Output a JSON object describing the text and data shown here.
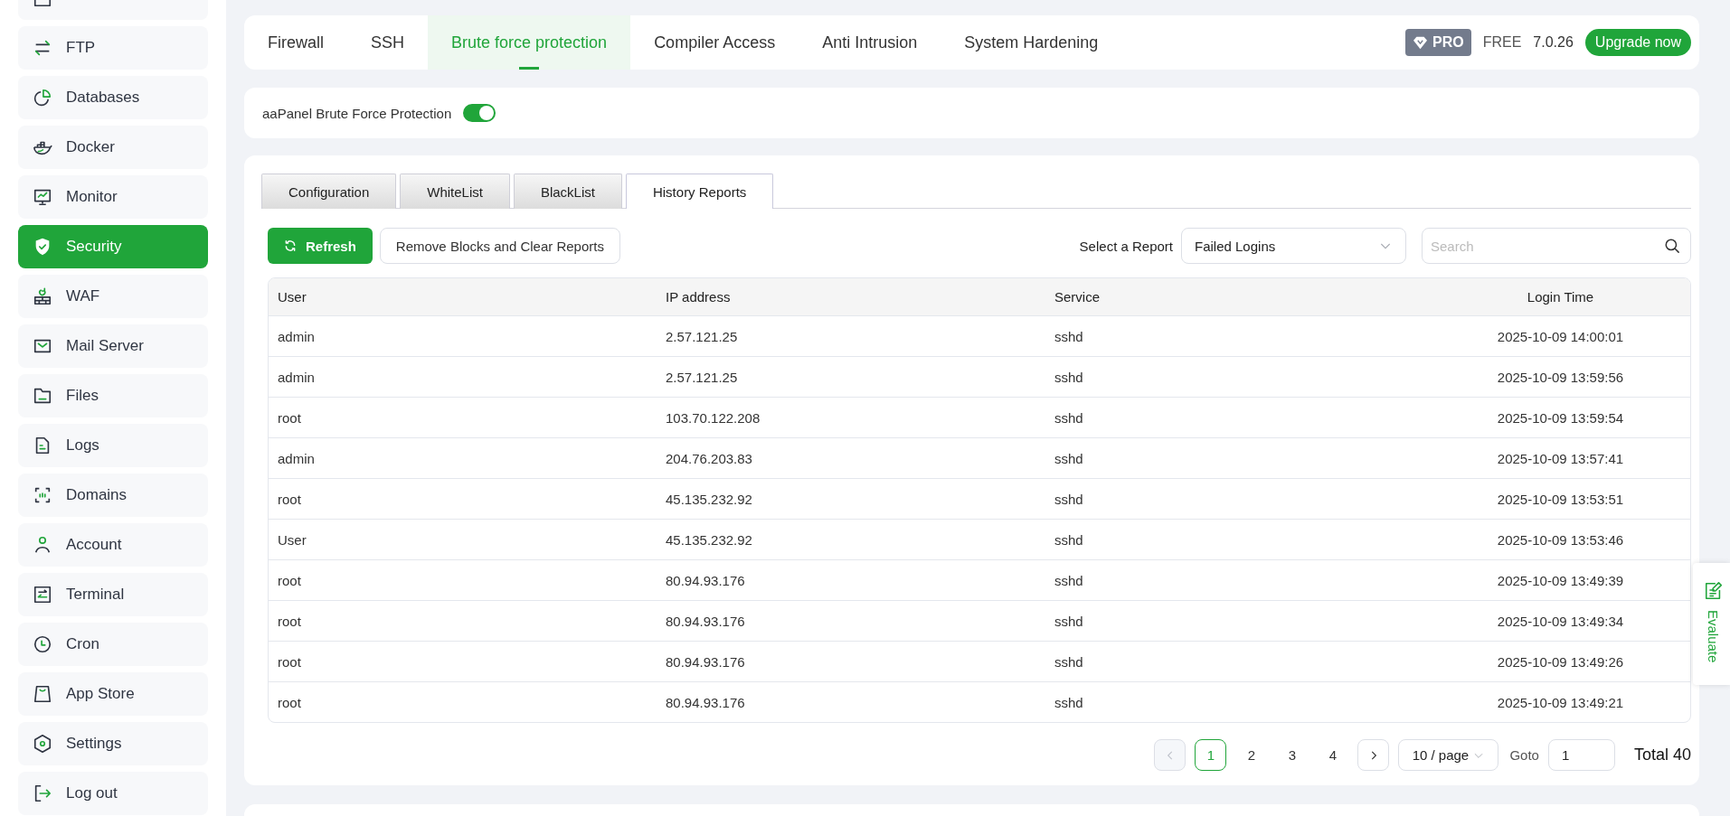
{
  "sidebar": {
    "items": [
      {
        "label": "FTP",
        "selected": false
      },
      {
        "label": "Databases",
        "selected": false
      },
      {
        "label": "Docker",
        "selected": false
      },
      {
        "label": "Monitor",
        "selected": false
      },
      {
        "label": "Security",
        "selected": true
      },
      {
        "label": "WAF",
        "selected": false
      },
      {
        "label": "Mail Server",
        "selected": false
      },
      {
        "label": "Files",
        "selected": false
      },
      {
        "label": "Logs",
        "selected": false
      },
      {
        "label": "Domains",
        "selected": false
      },
      {
        "label": "Account",
        "selected": false
      },
      {
        "label": "Terminal",
        "selected": false
      },
      {
        "label": "Cron",
        "selected": false
      },
      {
        "label": "App Store",
        "selected": false
      },
      {
        "label": "Settings",
        "selected": false
      },
      {
        "label": "Log out",
        "selected": false
      }
    ]
  },
  "top_tabs": [
    {
      "label": "Firewall",
      "selected": false
    },
    {
      "label": "SSH",
      "selected": false
    },
    {
      "label": "Brute force protection",
      "selected": true
    },
    {
      "label": "Compiler Access",
      "selected": false
    },
    {
      "label": "Anti Intrusion",
      "selected": false
    },
    {
      "label": "System Hardening",
      "selected": false
    }
  ],
  "edition": {
    "badge": "PRO",
    "plan": "FREE",
    "version": "7.0.26",
    "upgrade_button": "Upgrade now"
  },
  "protection": {
    "label": "aaPanel Brute Force Protection",
    "on": true
  },
  "sub_tabs": [
    {
      "label": "Configuration",
      "selected": false
    },
    {
      "label": "WhiteList",
      "selected": false
    },
    {
      "label": "BlackList",
      "selected": false
    },
    {
      "label": "History Reports",
      "selected": true
    }
  ],
  "toolbar": {
    "refresh_button": "Refresh",
    "clear_button": "Remove Blocks and Clear Reports",
    "report_label": "Select a Report",
    "report_select": "Failed Logins",
    "search": {
      "placeholder": "Search"
    }
  },
  "table": {
    "columns": [
      "User",
      "IP address",
      "Service",
      "Login Time"
    ],
    "rows": [
      [
        "admin",
        "2.57.121.25",
        "sshd",
        "2025-10-09 14:00:01"
      ],
      [
        "admin",
        "2.57.121.25",
        "sshd",
        "2025-10-09 13:59:56"
      ],
      [
        "root",
        "103.70.122.208",
        "sshd",
        "2025-10-09 13:59:54"
      ],
      [
        "admin",
        "204.76.203.83",
        "sshd",
        "2025-10-09 13:57:41"
      ],
      [
        "root",
        "45.135.232.92",
        "sshd",
        "2025-10-09 13:53:51"
      ],
      [
        "User",
        "45.135.232.92",
        "sshd",
        "2025-10-09 13:53:46"
      ],
      [
        "root",
        "80.94.93.176",
        "sshd",
        "2025-10-09 13:49:39"
      ],
      [
        "root",
        "80.94.93.176",
        "sshd",
        "2025-10-09 13:49:34"
      ],
      [
        "root",
        "80.94.93.176",
        "sshd",
        "2025-10-09 13:49:26"
      ],
      [
        "root",
        "80.94.93.176",
        "sshd",
        "2025-10-09 13:49:21"
      ]
    ]
  },
  "pagination": {
    "prev": {
      "disabled": true
    },
    "pages": [
      {
        "label": "1",
        "selected": true
      },
      {
        "label": "2",
        "selected": false
      },
      {
        "label": "3",
        "selected": false
      },
      {
        "label": "4",
        "selected": false
      }
    ],
    "next": {
      "disabled": false
    },
    "page_size": "10 / page",
    "goto_label": "Goto",
    "goto_value": "1",
    "total": "Total 40"
  },
  "evaluate": {
    "label": "Evaluate"
  }
}
